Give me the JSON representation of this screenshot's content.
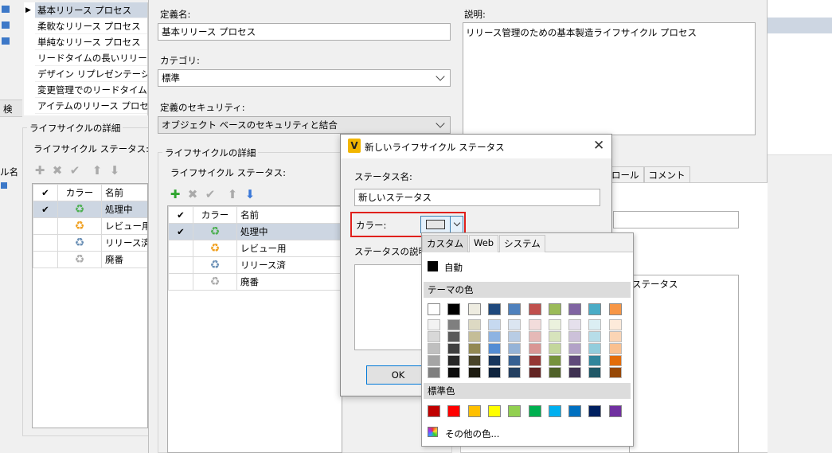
{
  "definitions": [
    "基本リリース プロセス",
    "柔軟なリリース プロセス",
    "単純なリリース プロセス",
    "リードタイムの長いリリース処理",
    "デザイン リプレゼンテーション プ",
    "変更管理でのリードタイムの長",
    "アイテムのリリース プロセス"
  ],
  "left_lifecycle": {
    "group_label": "ライフサイクルの詳細",
    "statuses_label": "ライフサイクル ステータス:",
    "headers": [
      "✔",
      "カラー",
      "名前"
    ],
    "rows": [
      {
        "check": "✔",
        "name": "処理中",
        "color": "#4caf50"
      },
      {
        "check": "",
        "name": "レビュー用",
        "color": "#f0a020"
      },
      {
        "check": "",
        "name": "リリース済",
        "color": "#6a8fb5"
      },
      {
        "check": "",
        "name": "廃番",
        "color": "#aaaaaa"
      }
    ]
  },
  "left_edge": {
    "label1": "検",
    "label2": "ル名"
  },
  "form": {
    "name_label": "定義名:",
    "name_value": "基本リリース プロセス",
    "category_label": "カテゴリ:",
    "category_value": "標準",
    "security_label": "定義のセキュリティ:",
    "security_value": "オブジェクト ベースのセキュリティと結合",
    "description_label": "説明:",
    "description_value": "リリース管理のための基本製造ライフサイクル プロセス"
  },
  "mid_lifecycle": {
    "group_label": "ライフサイクルの詳細",
    "statuses_label": "ライフサイクル ステータス:",
    "headers": [
      "✔",
      "カラー",
      "名前"
    ],
    "rows": [
      {
        "check": "✔",
        "name": "処理中",
        "color": "#4caf50"
      },
      {
        "check": "",
        "name": "レビュー用",
        "color": "#f0a020"
      },
      {
        "check": "",
        "name": "リリース済",
        "color": "#6a8fb5"
      },
      {
        "check": "",
        "name": "廃番",
        "color": "#aaaaaa"
      }
    ]
  },
  "right_tabs": [
    "ロール",
    "コメント"
  ],
  "right_partial_text": "ステータス",
  "dialog": {
    "title": "新しいライフサイクル ステータス",
    "icon_letter": "V",
    "name_label": "ステータス名:",
    "name_value": "新しいステータス",
    "color_label": "カラー:",
    "desc_label": "ステータスの説明:",
    "ok_label": "OK"
  },
  "picker": {
    "tabs": [
      "カスタム",
      "Web",
      "システム"
    ],
    "auto_label": "自動",
    "theme_label": "テーマの色",
    "standard_label": "標準色",
    "more_label": "その他の色...",
    "theme_top": [
      "#ffffff",
      "#000000",
      "#eeece1",
      "#1f497d",
      "#4f81bd",
      "#c0504d",
      "#9bbb59",
      "#8064a2",
      "#4bacc6",
      "#f79646"
    ],
    "theme_shades": [
      [
        "#f2f2f2",
        "#7f7f7f",
        "#ddd9c3",
        "#c6d9f0",
        "#dbe5f1",
        "#f2dcdb",
        "#ebf1dd",
        "#e5e0ec",
        "#dbeef3",
        "#fdeada"
      ],
      [
        "#d8d8d8",
        "#595959",
        "#c4bd97",
        "#8db3e2",
        "#b8cce4",
        "#e5b9b7",
        "#d7e3bc",
        "#ccc1d9",
        "#b7dde8",
        "#fbd5b5"
      ],
      [
        "#bfbfbf",
        "#3f3f3f",
        "#938953",
        "#548dd4",
        "#95b3d7",
        "#d99694",
        "#c3d69b",
        "#b2a2c7",
        "#92cddc",
        "#fac08f"
      ],
      [
        "#a5a5a5",
        "#262626",
        "#494429",
        "#17365d",
        "#366092",
        "#953734",
        "#76923c",
        "#5f497a",
        "#31859b",
        "#e36c09"
      ],
      [
        "#7f7f7f",
        "#0c0c0c",
        "#1d1b10",
        "#0f243e",
        "#244061",
        "#632423",
        "#4f6128",
        "#3f3151",
        "#205867",
        "#974806"
      ]
    ],
    "standard": [
      "#c00000",
      "#ff0000",
      "#ffc000",
      "#ffff00",
      "#92d050",
      "#00b050",
      "#00b0f0",
      "#0070c0",
      "#002060",
      "#7030a0"
    ]
  }
}
